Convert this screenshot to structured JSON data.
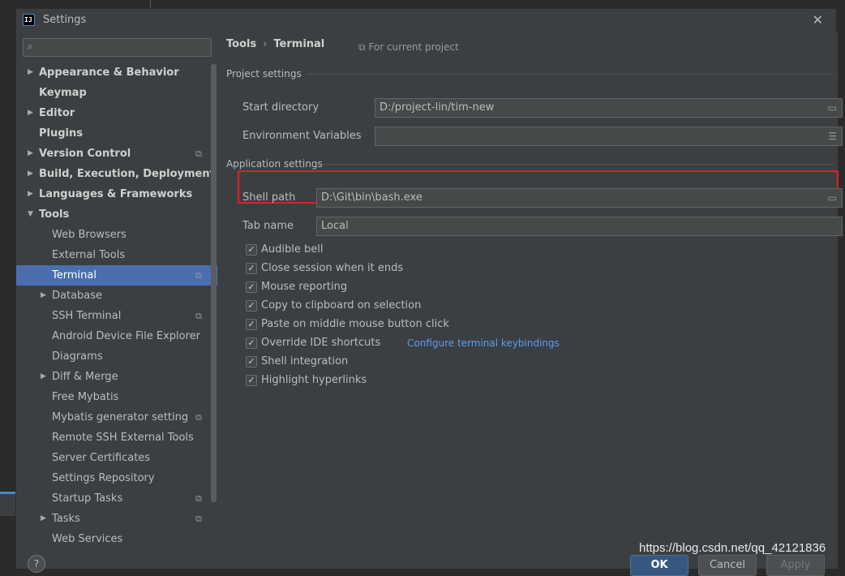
{
  "window": {
    "title": "Settings",
    "app_icon_text": "IJ",
    "close_glyph": "✕"
  },
  "search": {
    "placeholder": "",
    "icon": "search-icon"
  },
  "sidebar": {
    "items": [
      {
        "label": "Appearance & Behavior",
        "bold": true,
        "arrow": "▶",
        "level": 0
      },
      {
        "label": "Keymap",
        "bold": true,
        "arrow": "",
        "level": 0
      },
      {
        "label": "Editor",
        "bold": true,
        "arrow": "▶",
        "level": 0
      },
      {
        "label": "Plugins",
        "bold": true,
        "arrow": "",
        "level": 0
      },
      {
        "label": "Version Control",
        "bold": true,
        "arrow": "▶",
        "level": 0,
        "project": true
      },
      {
        "label": "Build, Execution, Deployment",
        "bold": true,
        "arrow": "▶",
        "level": 0
      },
      {
        "label": "Languages & Frameworks",
        "bold": true,
        "arrow": "▶",
        "level": 0
      },
      {
        "label": "Tools",
        "bold": true,
        "arrow": "▼",
        "level": 0
      },
      {
        "label": "Web Browsers",
        "bold": false,
        "arrow": "",
        "level": 1
      },
      {
        "label": "External Tools",
        "bold": false,
        "arrow": "",
        "level": 1
      },
      {
        "label": "Terminal",
        "bold": false,
        "arrow": "",
        "level": 1,
        "selected": true,
        "project": true
      },
      {
        "label": "Database",
        "bold": false,
        "arrow": "▶",
        "level": 1
      },
      {
        "label": "SSH Terminal",
        "bold": false,
        "arrow": "",
        "level": 1,
        "project": true
      },
      {
        "label": "Android Device File Explorer",
        "bold": false,
        "arrow": "",
        "level": 1
      },
      {
        "label": "Diagrams",
        "bold": false,
        "arrow": "",
        "level": 1
      },
      {
        "label": "Diff & Merge",
        "bold": false,
        "arrow": "▶",
        "level": 1
      },
      {
        "label": "Free Mybatis",
        "bold": false,
        "arrow": "",
        "level": 1
      },
      {
        "label": "Mybatis generator setting",
        "bold": false,
        "arrow": "",
        "level": 1,
        "project": true
      },
      {
        "label": "Remote SSH External Tools",
        "bold": false,
        "arrow": "",
        "level": 1
      },
      {
        "label": "Server Certificates",
        "bold": false,
        "arrow": "",
        "level": 1
      },
      {
        "label": "Settings Repository",
        "bold": false,
        "arrow": "",
        "level": 1
      },
      {
        "label": "Startup Tasks",
        "bold": false,
        "arrow": "",
        "level": 1,
        "project": true
      },
      {
        "label": "Tasks",
        "bold": false,
        "arrow": "▶",
        "level": 1,
        "project": true
      },
      {
        "label": "Web Services",
        "bold": false,
        "arrow": "",
        "level": 1
      }
    ]
  },
  "breadcrumb": {
    "parent": "Tools",
    "separator": "›",
    "current": "Terminal"
  },
  "for_current_project": "For current project",
  "project_settings": {
    "heading": "Project settings",
    "start_directory_label": "Start directory",
    "start_directory_value": "D:/project-lin/tim-new",
    "env_vars_label": "Environment Variables",
    "env_vars_value": ""
  },
  "application_settings": {
    "heading": "Application settings",
    "shell_path_label": "Shell path",
    "shell_path_value": "D:\\Git\\bin\\bash.exe",
    "tab_name_label": "Tab name",
    "tab_name_value": "Local"
  },
  "checkboxes": [
    {
      "label": "Audible bell",
      "checked": true
    },
    {
      "label": "Close session when it ends",
      "checked": true
    },
    {
      "label": "Mouse reporting",
      "checked": true
    },
    {
      "label": "Copy to clipboard on selection",
      "checked": true
    },
    {
      "label": "Paste on middle mouse button click",
      "checked": true
    },
    {
      "label": "Override IDE shortcuts",
      "checked": true,
      "link": "Configure terminal keybindings"
    },
    {
      "label": "Shell integration",
      "checked": true
    },
    {
      "label": "Highlight hyperlinks",
      "checked": true
    }
  ],
  "buttons": {
    "ok": "OK",
    "cancel": "Cancel",
    "apply": "Apply"
  },
  "help_glyph": "?",
  "watermark": "https://blog.csdn.net/qq_42121836",
  "colors": {
    "selection": "#4b6eaf",
    "link": "#589df6",
    "highlight_box": "#e02020"
  }
}
